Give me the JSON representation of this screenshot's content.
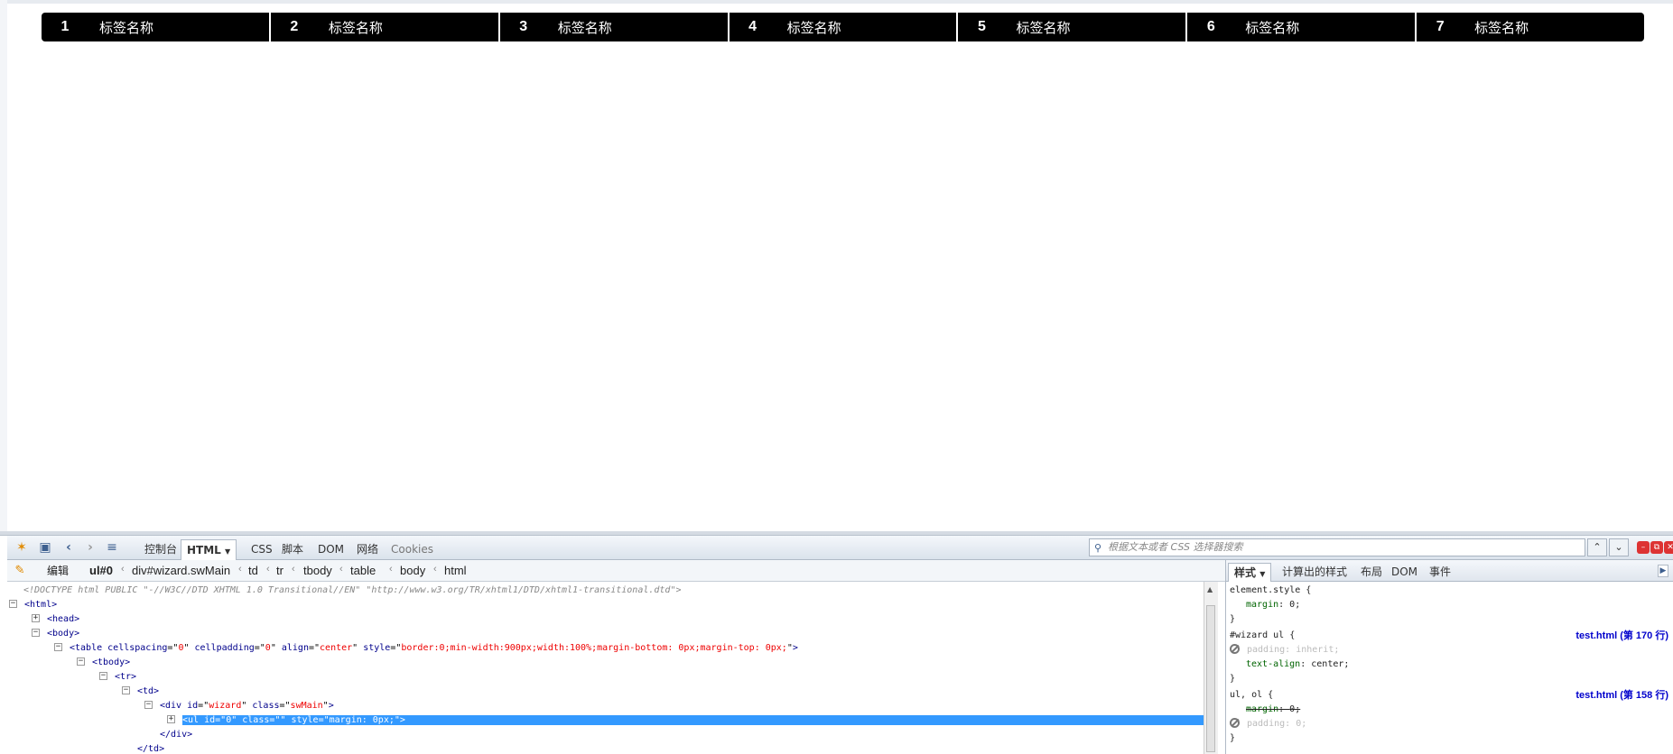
{
  "wizard": {
    "steps": [
      {
        "num": "1",
        "label": "标签名称"
      },
      {
        "num": "2",
        "label": "标签名称"
      },
      {
        "num": "3",
        "label": "标签名称"
      },
      {
        "num": "4",
        "label": "标签名称"
      },
      {
        "num": "5",
        "label": "标签名称"
      },
      {
        "num": "6",
        "label": "标签名称"
      },
      {
        "num": "7",
        "label": "标签名称"
      }
    ]
  },
  "devtools": {
    "panel_tabs": [
      "控制台",
      "HTML",
      "CSS",
      "脚本",
      "DOM",
      "网络",
      "Cookies"
    ],
    "active_panel": "HTML",
    "search_placeholder": "根据文本或者 CSS 选择器搜索",
    "edit_label": "编辑",
    "breadcrumbs": [
      "ul#0",
      "div#wizard.swMain",
      "td",
      "tr",
      "tbody",
      "table",
      "body",
      "html"
    ],
    "tree": {
      "doctype": "<!DOCTYPE html PUBLIC \"-//W3C//DTD XHTML 1.0 Transitional//EN\" \"http://www.w3.org/TR/xhtml1/DTD/xhtml1-transitional.dtd\">",
      "html_open": "<html>",
      "head": "<head>",
      "body_open": "<body>",
      "table_tag": "<table",
      "table_attrs": [
        {
          "name": "cellspacing",
          "value": "0"
        },
        {
          "name": "cellpadding",
          "value": "0"
        },
        {
          "name": "align",
          "value": "center"
        },
        {
          "name": "style",
          "value": "border:0;min-width:900px;width:100%;margin-bottom: 0px;margin-top: 0px;"
        }
      ],
      "tbody_open": "<tbody>",
      "tr_open": "<tr>",
      "td_open": "<td>",
      "div_tag": "<div",
      "div_attrs": [
        {
          "name": "id",
          "value": "wizard"
        },
        {
          "name": "class",
          "value": "swMain"
        }
      ],
      "ul_tag": "<ul",
      "ul_attrs": [
        {
          "name": "id",
          "value": "0"
        },
        {
          "name": "class",
          "value": ""
        },
        {
          "name": "style",
          "value": "margin: 0px;"
        }
      ],
      "div_close": "</div>",
      "td_close": "</td>"
    },
    "side_tabs": [
      "样式",
      "计算出的样式",
      "布局",
      "DOM",
      "事件"
    ],
    "active_side_tab": "样式",
    "style_rules": [
      {
        "selector": "element.style {",
        "source": "",
        "props": [
          {
            "name": "margin",
            "value": "0;",
            "state": "normal"
          }
        ]
      },
      {
        "selector": "#wizard ul {",
        "source": "test.html (第 170 行)",
        "props": [
          {
            "name": "padding",
            "value": "inherit;",
            "state": "disabled"
          },
          {
            "name": "text-align",
            "value": "center;",
            "state": "normal"
          }
        ]
      },
      {
        "selector": "ul, ol {",
        "source": "test.html (第 158 行)",
        "props": [
          {
            "name": "margin",
            "value": "0;",
            "state": "overridden"
          },
          {
            "name": "padding",
            "value": "0;",
            "state": "disabled"
          }
        ]
      }
    ],
    "brace_close": "}"
  }
}
